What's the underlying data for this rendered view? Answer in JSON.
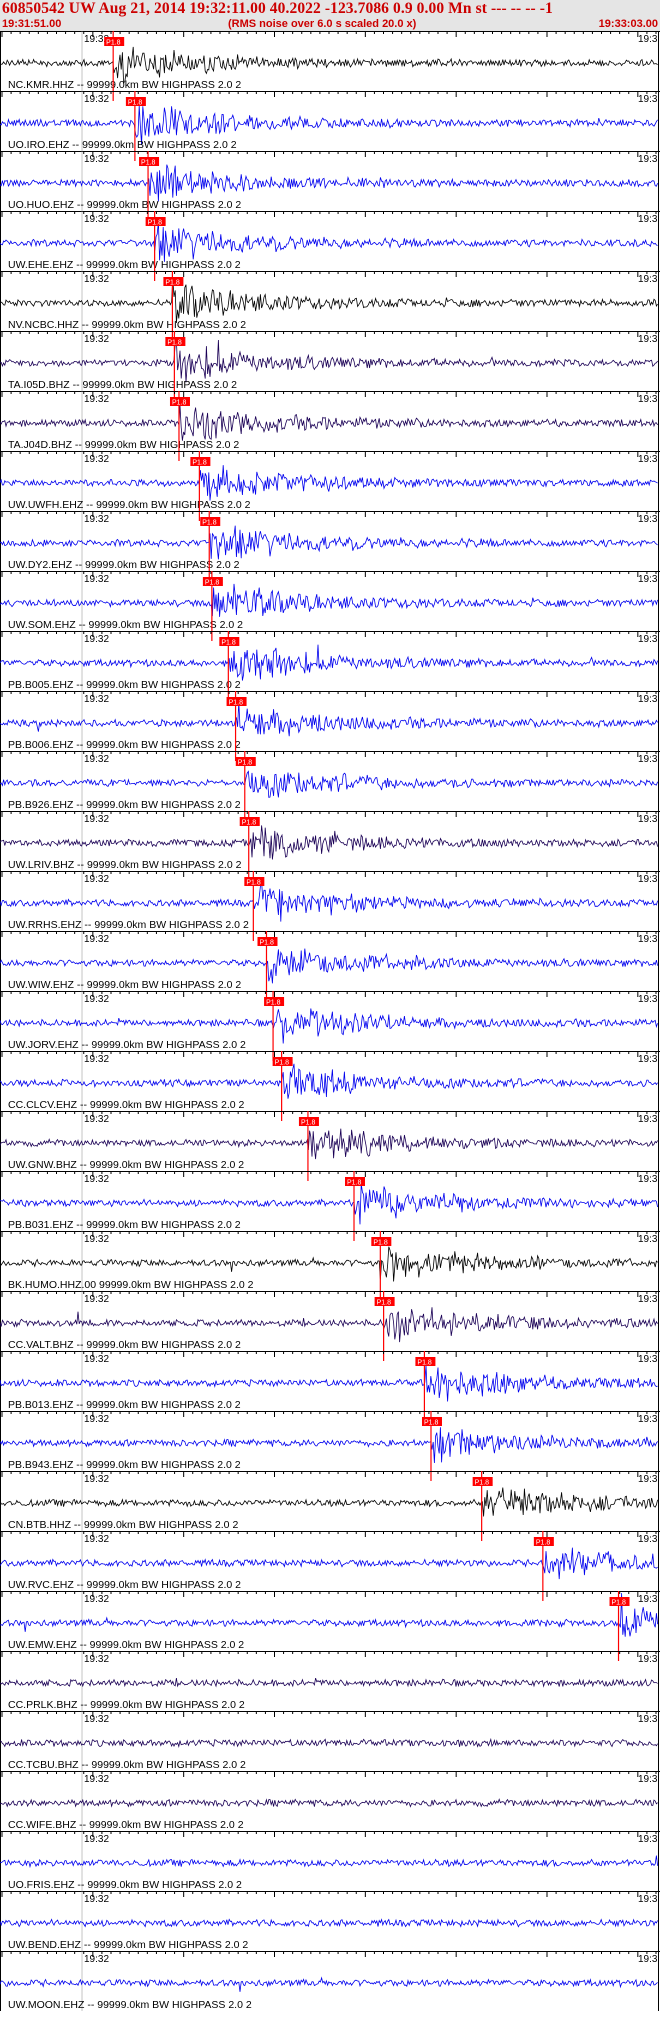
{
  "header": {
    "title": "60850542 UW Aug 21, 2014 19:32:11.00   40.2022 -123.7086  0.9 0.00 Mn st --- -- --  -1",
    "start_time": "19:31:51.00",
    "subtitle": "(RMS noise over 6.0 s scaled 20.0 x)",
    "end_time": "19:33:03.00",
    "minute_label": "19:32",
    "right_label": "19:3"
  },
  "colors": {
    "header_bg": "#e5e5e5",
    "header_text": "#cc0000",
    "pick": "#ff0000",
    "trace_black": "#000000",
    "trace_blue": "#0000ee",
    "trace_navy": "#1a0055"
  },
  "pick_label": "P1.8",
  "traces": [
    {
      "label": "NC.KMR.HHZ -- 99999.0km BW  HIGHPASS  2.0  2",
      "color": "black",
      "pick": 0.172
    },
    {
      "label": "UO.IRO.EHZ -- 99999.0km BW  HIGHPASS  2.0  2",
      "color": "blue",
      "pick": 0.205
    },
    {
      "label": "UO.HUO.EHZ -- 99999.0km BW  HIGHPASS  2.0  2",
      "color": "blue",
      "pick": 0.225
    },
    {
      "label": "UW.EHE.EHZ -- 99999.0km BW  HIGHPASS  2.0  2",
      "color": "blue",
      "pick": 0.235
    },
    {
      "label": "NV.NCBC.HHZ -- 99999.0km BW  HIGHPASS  2.0  2",
      "color": "black",
      "pick": 0.262
    },
    {
      "label": "TA.I05D.BHZ -- 99999.0km BW  HIGHPASS  2.0  2",
      "color": "navy",
      "pick": 0.265
    },
    {
      "label": "TA.J04D.BHZ -- 99999.0km BW  HIGHPASS  2.0  2",
      "color": "navy",
      "pick": 0.272
    },
    {
      "label": "UW.UWFH.EHZ -- 99999.0km BW  HIGHPASS  2.0  2",
      "color": "blue",
      "pick": 0.303
    },
    {
      "label": "UW.DY2.EHZ -- 99999.0km BW  HIGHPASS  2.0  2",
      "color": "blue",
      "pick": 0.318
    },
    {
      "label": "UW.SOM.EHZ -- 99999.0km BW  HIGHPASS  2.0  2",
      "color": "blue",
      "pick": 0.322
    },
    {
      "label": "PB.B005.EHZ -- 99999.0km BW  HIGHPASS  2.0  2",
      "color": "blue",
      "pick": 0.347
    },
    {
      "label": "PB.B006.EHZ -- 99999.0km BW  HIGHPASS  2.0  2",
      "color": "blue",
      "pick": 0.358
    },
    {
      "label": "PB.B926.EHZ -- 99999.0km BW  HIGHPASS  2.0  2",
      "color": "blue",
      "pick": 0.372
    },
    {
      "label": "UW.LRIV.BHZ -- 99999.0km BW  HIGHPASS  2.0  2",
      "color": "navy",
      "pick": 0.378
    },
    {
      "label": "UW.RRHS.EHZ -- 99999.0km BW  HIGHPASS  2.0  2",
      "color": "blue",
      "pick": 0.385
    },
    {
      "label": "UW.WIW.EHZ -- 99999.0km BW  HIGHPASS  2.0  2",
      "color": "blue",
      "pick": 0.405
    },
    {
      "label": "UW.JORV.EHZ -- 99999.0km BW  HIGHPASS  2.0  2",
      "color": "blue",
      "pick": 0.415
    },
    {
      "label": "CC.CLCV.EHZ -- 99999.0km BW  HIGHPASS  2.0  2",
      "color": "blue",
      "pick": 0.428
    },
    {
      "label": "UW.GNW.BHZ -- 99999.0km BW  HIGHPASS  2.0  2",
      "color": "navy",
      "pick": 0.468
    },
    {
      "label": "PB.B031.EHZ -- 99999.0km BW  HIGHPASS  2.0  2",
      "color": "blue",
      "pick": 0.538
    },
    {
      "label": "BK.HUMO.HHZ.00 99999.0km BW  HIGHPASS  2.0  2",
      "color": "black",
      "pick": 0.578
    },
    {
      "label": "CC.VALT.BHZ -- 99999.0km BW  HIGHPASS  2.0  2",
      "color": "navy",
      "pick": 0.583
    },
    {
      "label": "PB.B013.EHZ -- 99999.0km BW  HIGHPASS  2.0  2",
      "color": "blue",
      "pick": 0.645
    },
    {
      "label": "PB.B943.EHZ -- 99999.0km BW  HIGHPASS  2.0  2",
      "color": "blue",
      "pick": 0.655
    },
    {
      "label": "CN.BTB.HHZ -- 99999.0km BW  HIGHPASS  2.0  2",
      "color": "black",
      "pick": 0.732
    },
    {
      "label": "UW.RVC.EHZ -- 99999.0km BW  HIGHPASS  2.0  2",
      "color": "blue",
      "pick": 0.825
    },
    {
      "label": "UW.EMW.EHZ -- 99999.0km BW  HIGHPASS  2.0  2",
      "color": "blue",
      "pick": 0.94
    },
    {
      "label": "CC.PRLK.BHZ -- 99999.0km BW  HIGHPASS  2.0  2",
      "color": "navy",
      "pick": null
    },
    {
      "label": "CC.TCBU.BHZ -- 99999.0km BW  HIGHPASS  2.0  2",
      "color": "navy",
      "pick": null
    },
    {
      "label": "CC.WIFE.BHZ -- 99999.0km BW  HIGHPASS  2.0  2",
      "color": "navy",
      "pick": null
    },
    {
      "label": "UO.FRIS.EHZ -- 99999.0km BW  HIGHPASS  2.0  2",
      "color": "blue",
      "pick": null
    },
    {
      "label": "UW.BEND.EHZ -- 99999.0km BW  HIGHPASS  2.0  2",
      "color": "blue",
      "pick": null
    },
    {
      "label": "UW.MOON.EHZ -- 99999.0km BW  HIGHPASS  2.0  2",
      "color": "blue",
      "pick": null
    }
  ]
}
